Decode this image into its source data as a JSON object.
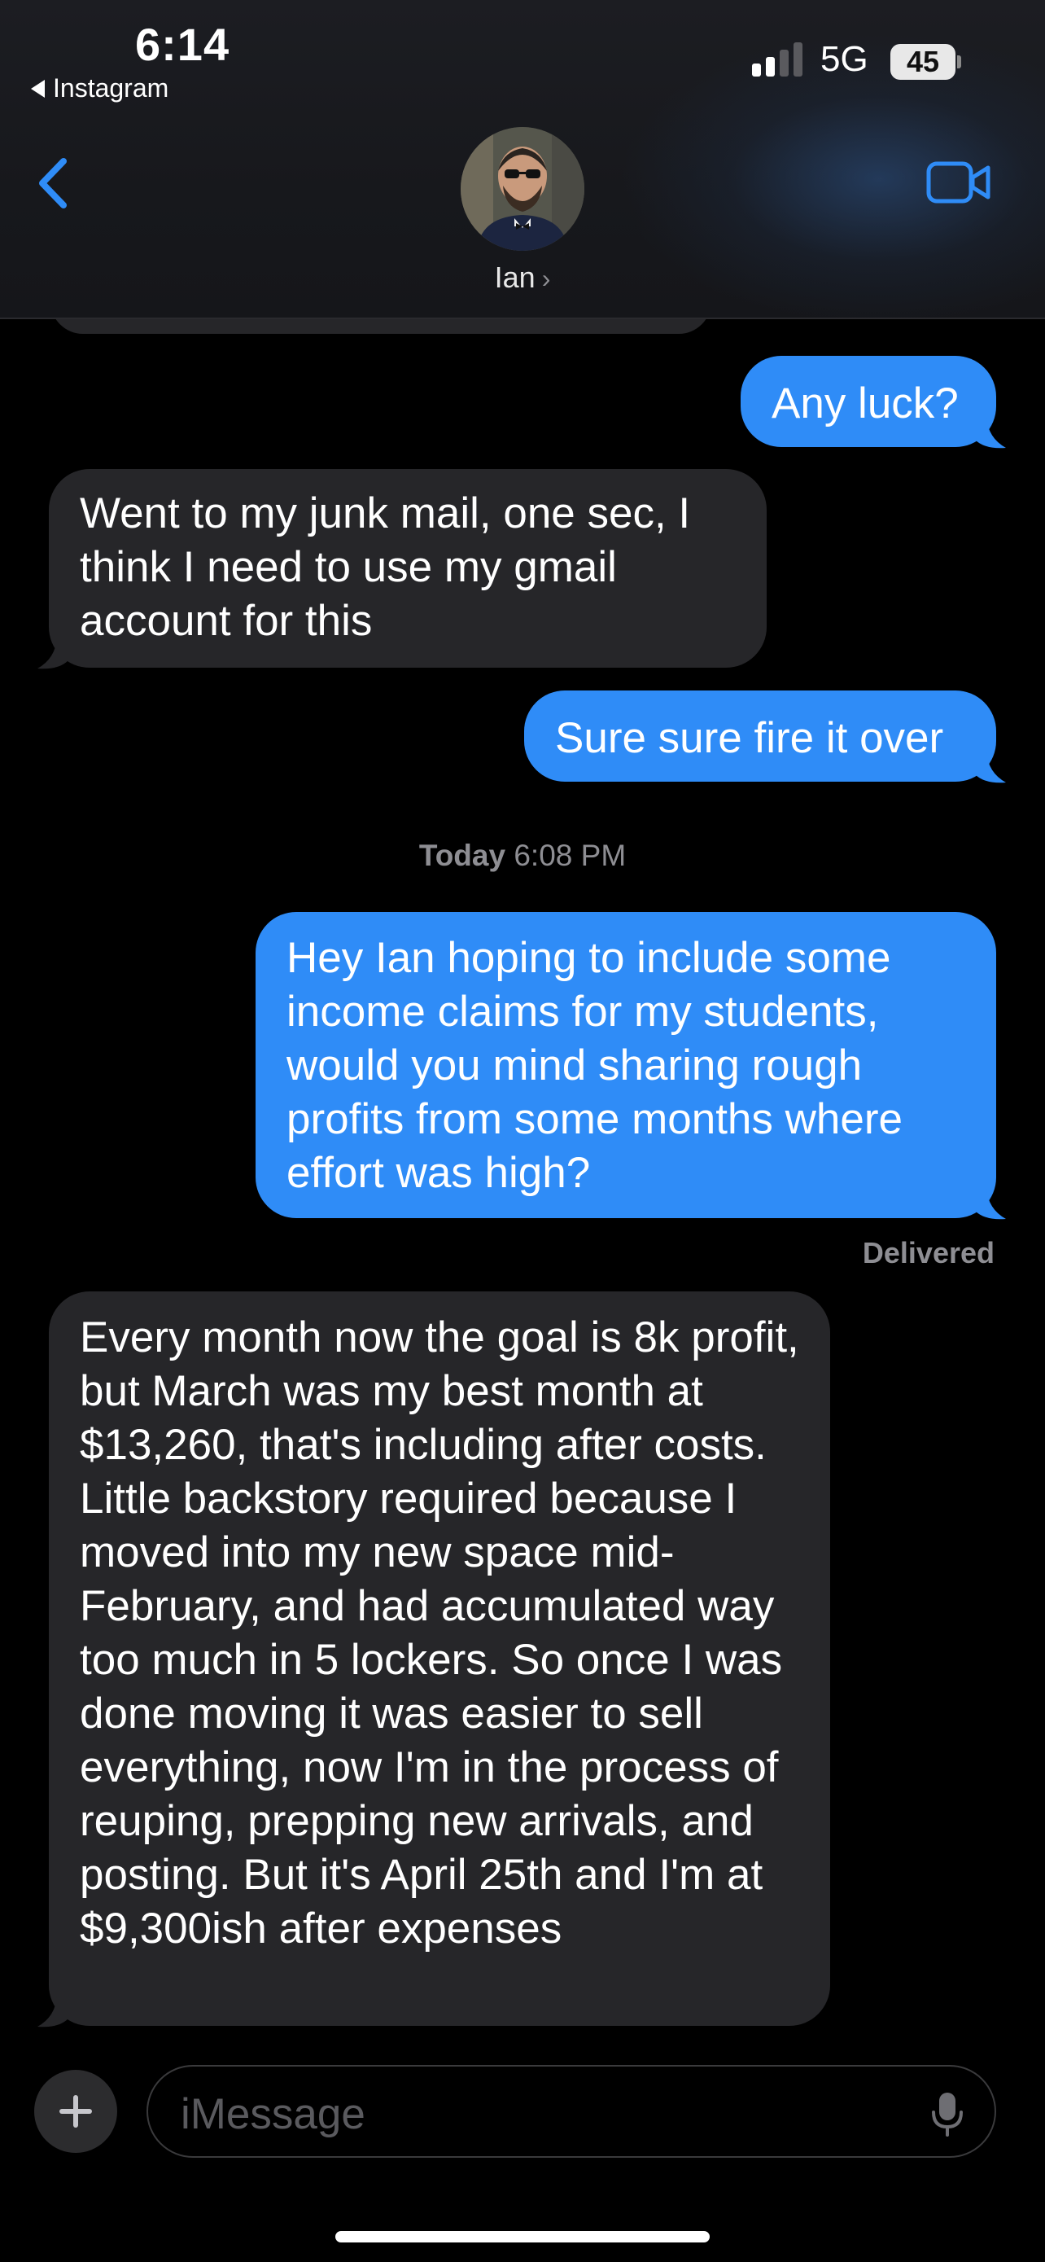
{
  "status_bar": {
    "time": "6:14",
    "back_app": "Instagram",
    "network": "5G",
    "battery": "45"
  },
  "header": {
    "contact_name": "Ian",
    "chevron": "›",
    "back_icon": "chevron-left-icon",
    "video_icon": "video-camera-icon",
    "accent": "#2f8cf7"
  },
  "messages": [
    {
      "direction": "out",
      "text": "Any luck?"
    },
    {
      "direction": "in",
      "text": "Went to my junk mail, one sec, I think I need to use my gmail account for this"
    },
    {
      "direction": "out",
      "text": "Sure sure fire it over"
    },
    {
      "direction": "out",
      "text": "Hey Ian hoping to include some income claims for my students, would you mind sharing rough profits from some months where effort was high?"
    },
    {
      "direction": "in",
      "text": "Every month now the goal is 8k profit, but March was my best month at $13,260, that's including after costs. Little backstory required because I moved into my new space mid-February, and had accumulated way too much in 5 lockers. So once I was done moving it was easier to sell everything, now I'm in the process of reuping, prepping new arrivals, and posting. But it's April 25th and I'm at $9,300ish after expenses"
    }
  ],
  "timestamp": {
    "day": "Today",
    "time": "6:08 PM"
  },
  "delivered_label": "Delivered",
  "composer": {
    "placeholder": "iMessage",
    "plus_icon": "plus-icon",
    "mic_icon": "microphone-icon"
  },
  "colors": {
    "outgoing": "#2f8cf7",
    "incoming": "#262629",
    "background": "#000000"
  }
}
